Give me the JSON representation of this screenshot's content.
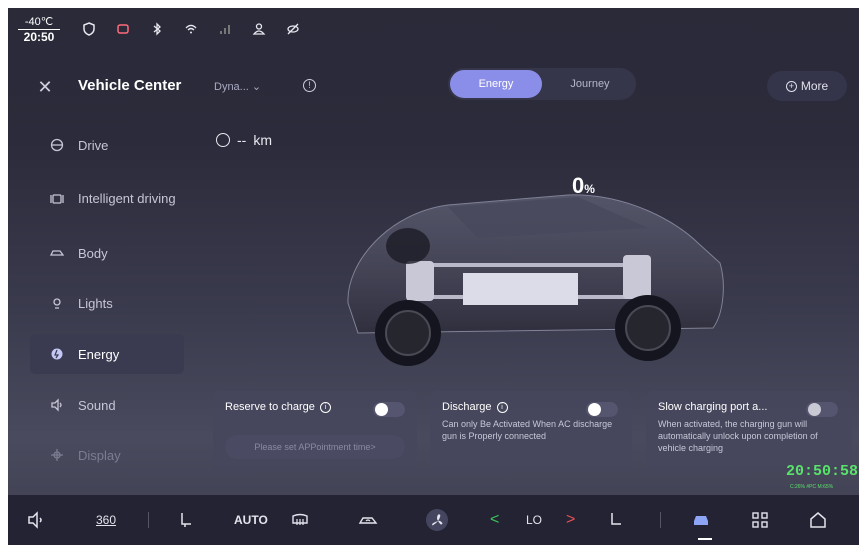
{
  "status": {
    "temperature": "-40℃",
    "time": "20:50",
    "icons": [
      "shield-icon",
      "battery-icon",
      "bluetooth-icon",
      "wifi-icon",
      "signal-icon",
      "user-icon",
      "hidden-eye-icon"
    ]
  },
  "header": {
    "title": "Vehicle Center",
    "mode_select": "Dyna...",
    "tabs": [
      {
        "label": "Energy",
        "active": true
      },
      {
        "label": "Journey",
        "active": false
      }
    ],
    "more_label": "More"
  },
  "sidebar": {
    "items": [
      {
        "label": "Drive",
        "icon": "steering-wheel-icon"
      },
      {
        "label": "Intelligent driving",
        "icon": "intelligent-driving-icon"
      },
      {
        "label": "Body",
        "icon": "car-body-icon"
      },
      {
        "label": "Lights",
        "icon": "light-icon"
      },
      {
        "label": "Energy",
        "icon": "energy-icon",
        "active": true
      },
      {
        "label": "Sound",
        "icon": "speaker-icon"
      },
      {
        "label": "Display",
        "icon": "display-icon"
      }
    ]
  },
  "energy": {
    "range_value": "--",
    "range_unit": "km",
    "battery_percent": "0",
    "percent_unit": "%"
  },
  "cards": {
    "reserve": {
      "title": "Reserve to charge",
      "placeholder": "Please set APPointment time>",
      "enabled": false
    },
    "discharge": {
      "title": "Discharge",
      "desc": "Can only Be Activated When AC discharge gun is Properly connected",
      "enabled": false
    },
    "slow_port": {
      "title": "Slow charging port a...",
      "desc": "When activated, the charging gun will automatically unlock upon completion of vehicle charging",
      "enabled": false
    }
  },
  "overlay": {
    "clock": "20:50:58",
    "stats": "C:26% #PC M:65%"
  },
  "bottombar": {
    "view360": "360",
    "auto": "AUTO",
    "temp": "LO"
  }
}
